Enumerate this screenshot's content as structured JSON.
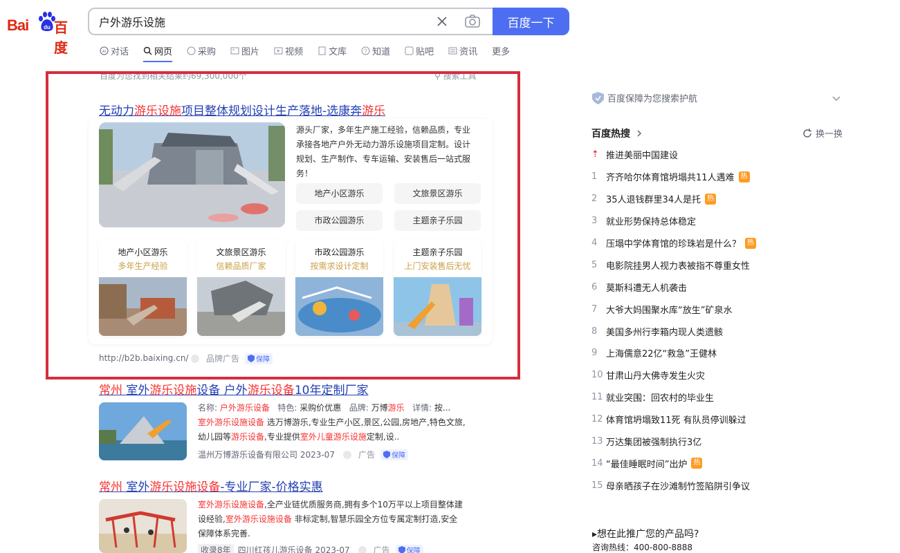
{
  "logo": {
    "text_bai": "Bai",
    "text_cn": "百度"
  },
  "search": {
    "query": "户外游乐设施",
    "button_label": "百度一下"
  },
  "tabs": [
    {
      "label": "对话",
      "icon": "ai-chat-icon"
    },
    {
      "label": "网页",
      "icon": "search-icon",
      "active": true
    },
    {
      "label": "采购",
      "icon": "purchase-icon"
    },
    {
      "label": "图片",
      "icon": "image-icon"
    },
    {
      "label": "视频",
      "icon": "video-icon"
    },
    {
      "label": "文库",
      "icon": "library-icon"
    },
    {
      "label": "知道",
      "icon": "question-icon"
    },
    {
      "label": "贴吧",
      "icon": "tieba-icon"
    },
    {
      "label": "资讯",
      "icon": "news-icon"
    },
    {
      "label": "更多",
      "icon": ""
    }
  ],
  "result_count": "百度为您找到相关结果约69,300,000个",
  "search_tools": "搜索工具",
  "ad": {
    "title_pre": "无动力",
    "title_kw1": "游乐设施",
    "title_mid": "项目整体规划设计生产落地-选康奔",
    "title_kw2": "游乐",
    "description": "源头厂家，多年生产施工经验，信赖品质，专业承接各地产户外无动力游乐设施项目定制。设计规划、生产制作、专车运输、安装售后一站式服务！",
    "chips": [
      "地产小区游乐",
      "文旅景区游乐",
      "市政公园游乐",
      "主题亲子乐园"
    ],
    "cards": [
      {
        "title": "地产小区游乐",
        "subtitle": "多年生产经验"
      },
      {
        "title": "文旅景区游乐",
        "subtitle": "信赖品质厂家"
      },
      {
        "title": "市政公园游乐",
        "subtitle": "按需求设计定制"
      },
      {
        "title": "主题亲子乐园",
        "subtitle": "上门安装售后无忧"
      }
    ],
    "url": "http://b2b.baixing.cn/",
    "label": "品牌广告",
    "badge": "保障"
  },
  "result2": {
    "title_kw1": "常州",
    "title_mid": " 室外",
    "title_kw2": "游乐设施",
    "title_mid2": "设备 户外",
    "title_kw3": "游乐设备",
    "title_end": "10年定制厂家",
    "line1_label1": "名称:",
    "line1_val1_kw": "户外游乐设备",
    "line1_label2": "特色:",
    "line1_val2": "采购价优惠",
    "line1_label3": "品牌:",
    "line1_val3": "万博",
    "line1_val3_kw": "游乐",
    "line1_label4": "详情:",
    "line1_val4": "按...",
    "line2_kw": "室外游乐设施设备",
    "line2_rest": " 选万博游乐,专业生产小区,景区,公园,房地产,特色文旅,",
    "line3_pre": "幼儿园等",
    "line3_kw1": "游乐设备",
    "line3_mid": ",专业提供",
    "line3_kw2": "室外儿童游乐设施",
    "line3_end": "定制,设..",
    "source": "温州万博游乐设备有限公司 2023-07",
    "label": "广告",
    "badge": "保障"
  },
  "result3": {
    "title_kw1": "常州",
    "title_mid": " 室外",
    "title_kw2": "游乐设施设备",
    "title_end": "-专业厂家-价格实惠",
    "line1_kw": "室外游乐设施设备",
    "line1_rest": ",全产业链优质服务商,拥有多个10万平以上项目整体建",
    "line2_pre": "设经验,",
    "line2_kw": "室外游乐设施设备",
    "line2_rest": " 非标定制,智慧乐园全方位专属定制打造,安全",
    "line3": "保障体系完善.",
    "tag": "收录8年",
    "source": "四川红孩儿游乐设备 2023-07",
    "label": "广告",
    "badge": "保障"
  },
  "right": {
    "guard_text": "百度保障为您搜索护航",
    "hot_title": "百度热搜",
    "refresh_label": "换一换",
    "hot_items": [
      {
        "num": "",
        "text": "推进美丽中国建设",
        "hot": false,
        "top": true
      },
      {
        "num": "1",
        "text": "齐齐哈尔体育馆坍塌共11人遇难",
        "hot": true
      },
      {
        "num": "2",
        "text": "35人退钱群里34人是托",
        "hot": true
      },
      {
        "num": "3",
        "text": "就业形势保持总体稳定",
        "hot": false
      },
      {
        "num": "4",
        "text": "压塌中学体育馆的珍珠岩是什么？",
        "hot": true
      },
      {
        "num": "5",
        "text": "电影院挂男人视力表被指不尊重女性",
        "hot": false
      },
      {
        "num": "6",
        "text": "莫斯科遭无人机袭击",
        "hot": false
      },
      {
        "num": "7",
        "text": "大爷大妈围聚水库“放生”矿泉水",
        "hot": false
      },
      {
        "num": "8",
        "text": "美国多州行李箱内现人类遗骸",
        "hot": false
      },
      {
        "num": "9",
        "text": "上海儒意22亿“救急”王健林",
        "hot": false
      },
      {
        "num": "10",
        "text": "甘肃山丹大佛寺发生火灾",
        "hot": false
      },
      {
        "num": "11",
        "text": "就业突围：回农村的毕业生",
        "hot": false
      },
      {
        "num": "12",
        "text": "体育馆坍塌致11死 有队员停训躲过",
        "hot": false
      },
      {
        "num": "13",
        "text": "万达集团被强制执行3亿",
        "hot": false
      },
      {
        "num": "14",
        "text": "“最佳睡眠时间”出炉",
        "hot": true
      },
      {
        "num": "15",
        "text": "母亲晒孩子在沙滩制竹签陷阱引争议",
        "hot": false
      }
    ],
    "hot_badge": "热",
    "promo_title": "▸想在此推广您的产品吗?",
    "promo_phone": "咨询热线：400-800-8888"
  },
  "colors": {
    "accent": "#4e6ef2",
    "link": "#2440b3",
    "keyword": "#f73131",
    "frame": "#d62d3f",
    "hot": "#ff9b23"
  }
}
